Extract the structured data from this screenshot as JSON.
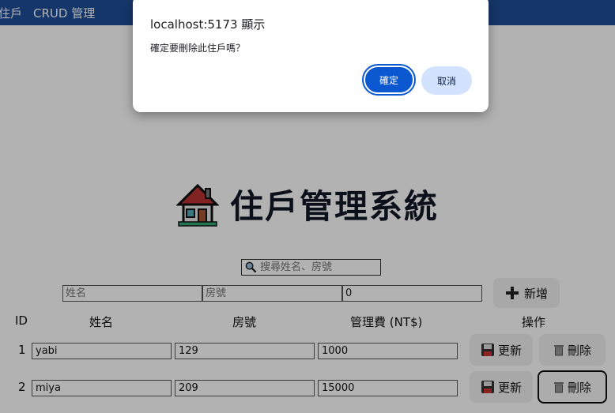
{
  "nav": {
    "item1": "住戶",
    "item2": "CRUD 管理"
  },
  "page": {
    "title": "住戶管理系統",
    "icon": "house-icon"
  },
  "search": {
    "placeholder": "搜尋姓名、房號",
    "icon": "magnifier-icon"
  },
  "add_form": {
    "name_placeholder": "姓名",
    "room_placeholder": "房號",
    "fee_value": "0",
    "add_label": "新增",
    "add_icon": "plus-icon"
  },
  "table": {
    "headers": {
      "id": "ID",
      "name": "姓名",
      "room": "房號",
      "fee": "管理費 (NT$)",
      "actions": "操作"
    },
    "rows": [
      {
        "id": "1",
        "name": "yabi",
        "room": "129",
        "fee": "1000"
      },
      {
        "id": "2",
        "name": "miya",
        "room": "209",
        "fee": "15000"
      }
    ],
    "update_label": "更新",
    "delete_label": "刪除",
    "update_icon": "floppy-disk-icon",
    "delete_icon": "trash-icon"
  },
  "dialog": {
    "title": "localhost:5173 顯示",
    "message": "確定要刪除此住戶嗎？",
    "ok_label": "確定",
    "cancel_label": "取消"
  },
  "colors": {
    "nav_bg": "#1f4e99",
    "primary": "#0b57d0",
    "secondary": "#d3e3fd"
  }
}
